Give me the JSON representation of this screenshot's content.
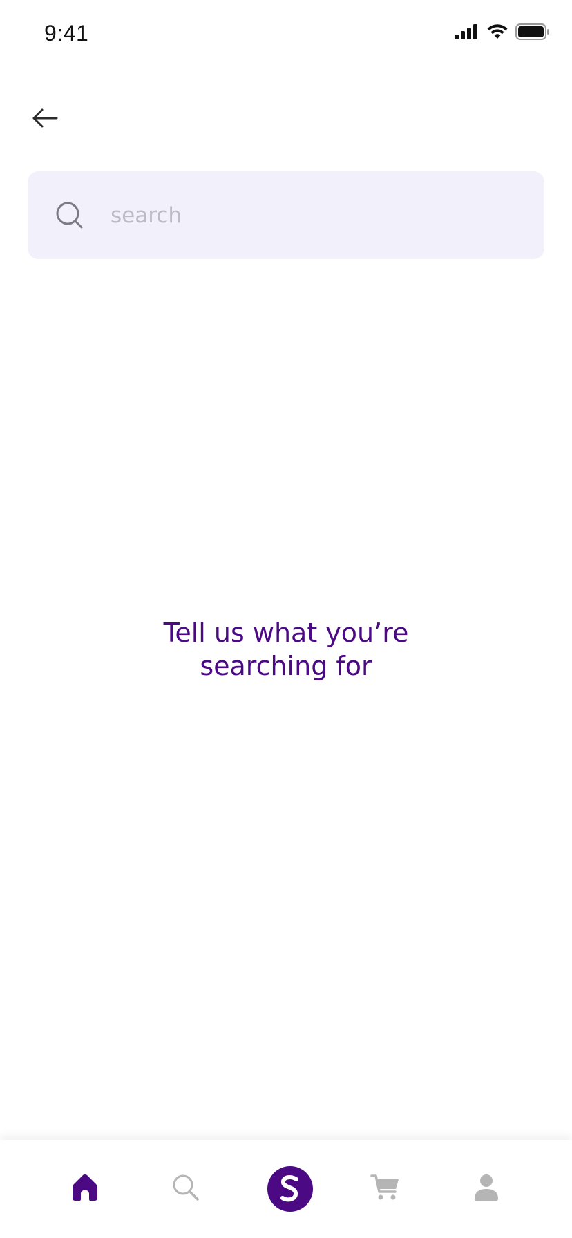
{
  "status_bar": {
    "time": "9:41",
    "icons": [
      "cellular-signal-icon",
      "wifi-icon",
      "battery-icon"
    ]
  },
  "header": {
    "back_icon": "arrow-left-icon"
  },
  "search": {
    "placeholder": "search",
    "value": "",
    "icon": "search-icon",
    "background_color": "#f1f0fb"
  },
  "empty_state": {
    "message": "Tell us what you’re searching for",
    "color": "#4b0a84"
  },
  "bottom_nav": {
    "items": [
      {
        "name": "home",
        "icon": "home-icon",
        "active": true
      },
      {
        "name": "search",
        "icon": "search-icon",
        "active": false
      },
      {
        "name": "brand",
        "icon": "brand-logo-icon",
        "active": false
      },
      {
        "name": "cart",
        "icon": "cart-icon",
        "active": false
      },
      {
        "name": "profile",
        "icon": "user-icon",
        "active": false
      }
    ],
    "active_color": "#4b0a84",
    "inactive_color": "#b5b5b5"
  }
}
